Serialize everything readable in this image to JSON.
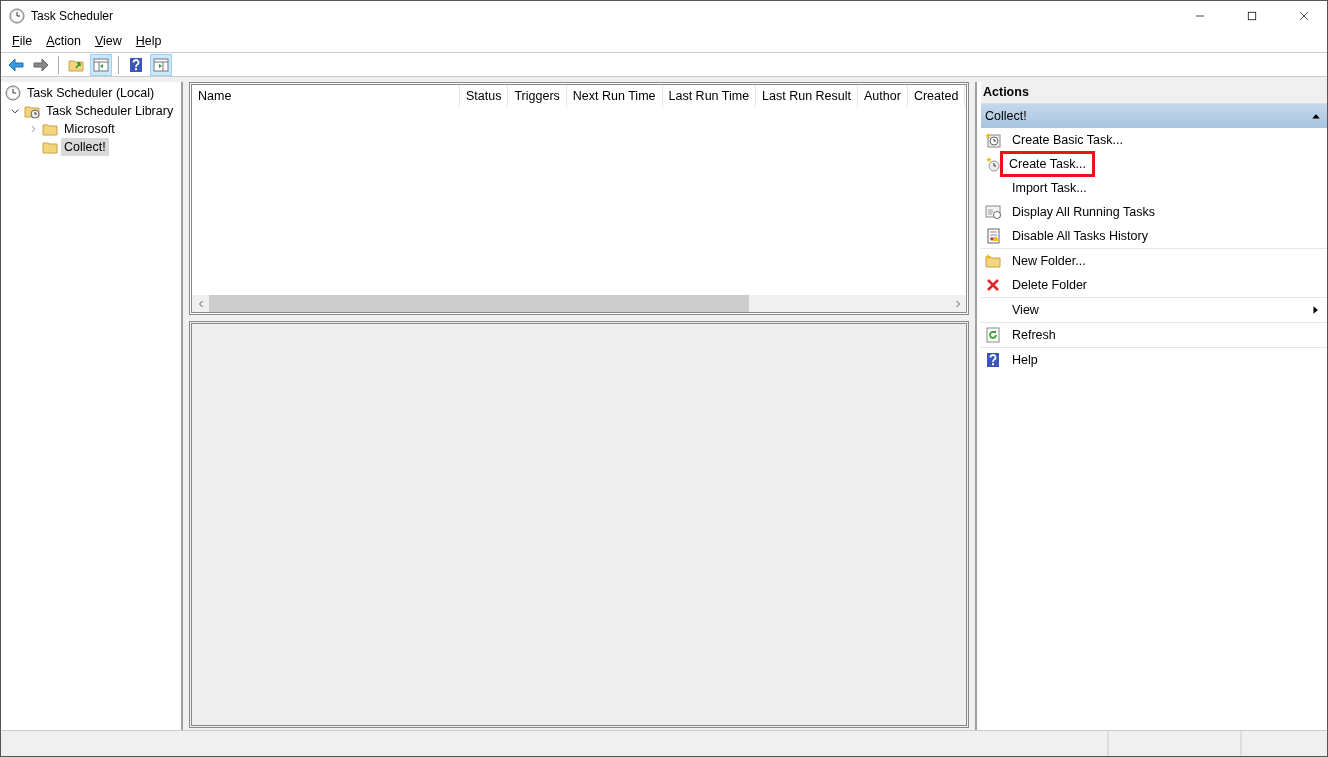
{
  "window": {
    "title": "Task Scheduler"
  },
  "menu": [
    {
      "label": "File"
    },
    {
      "label": "Action"
    },
    {
      "label": "View"
    },
    {
      "label": "Help"
    }
  ],
  "toolbar": [
    {
      "kind": "back",
      "pressed": false
    },
    {
      "kind": "forward",
      "pressed": false
    },
    {
      "kind": "sep"
    },
    {
      "kind": "up",
      "pressed": false
    },
    {
      "kind": "tree-pane",
      "pressed": true
    },
    {
      "kind": "sep"
    },
    {
      "kind": "help",
      "pressed": false
    },
    {
      "kind": "action-pane",
      "pressed": true
    }
  ],
  "tree": [
    {
      "label": "Task Scheduler (Local)",
      "kind": "clock",
      "selected": false,
      "children": [
        {
          "label": "Task Scheduler Library",
          "kind": "library",
          "expanded": true,
          "selected": false,
          "children": [
            {
              "label": "Microsoft",
              "kind": "folder",
              "expanded": false,
              "selected": false
            },
            {
              "label": "Collect!",
              "kind": "folder",
              "selected": true
            }
          ]
        }
      ]
    }
  ],
  "table": {
    "columns": [
      "Name",
      "Status",
      "Triggers",
      "Next Run Time",
      "Last Run Time",
      "Last Run Result",
      "Author",
      "Created"
    ],
    "scrollbar": {
      "level": 0.73
    }
  },
  "actions": {
    "title": "Actions",
    "section": {
      "label": "Collect!",
      "expanded": true
    },
    "groups": [
      [
        {
          "label": "Create Basic Task...",
          "kind": "basic",
          "highlighted": false
        },
        {
          "label": "Create Task...",
          "kind": "task",
          "highlighted": true
        },
        {
          "label": "Import Task...",
          "kind": "plain",
          "highlighted": false
        },
        {
          "label": "Display All Running Tasks",
          "kind": "running",
          "highlighted": false
        },
        {
          "label": "Disable All Tasks History",
          "kind": "history",
          "highlighted": false
        }
      ],
      [
        {
          "label": "New Folder...",
          "kind": "folder",
          "highlighted": false
        },
        {
          "label": "Delete Folder",
          "kind": "delete",
          "highlighted": false
        }
      ],
      [
        {
          "label": "View",
          "kind": "plain",
          "submenu": true,
          "highlighted": false
        }
      ],
      [
        {
          "label": "Refresh",
          "kind": "refresh",
          "highlighted": false
        }
      ],
      [
        {
          "label": "Help",
          "kind": "help",
          "highlighted": false
        }
      ]
    ]
  }
}
